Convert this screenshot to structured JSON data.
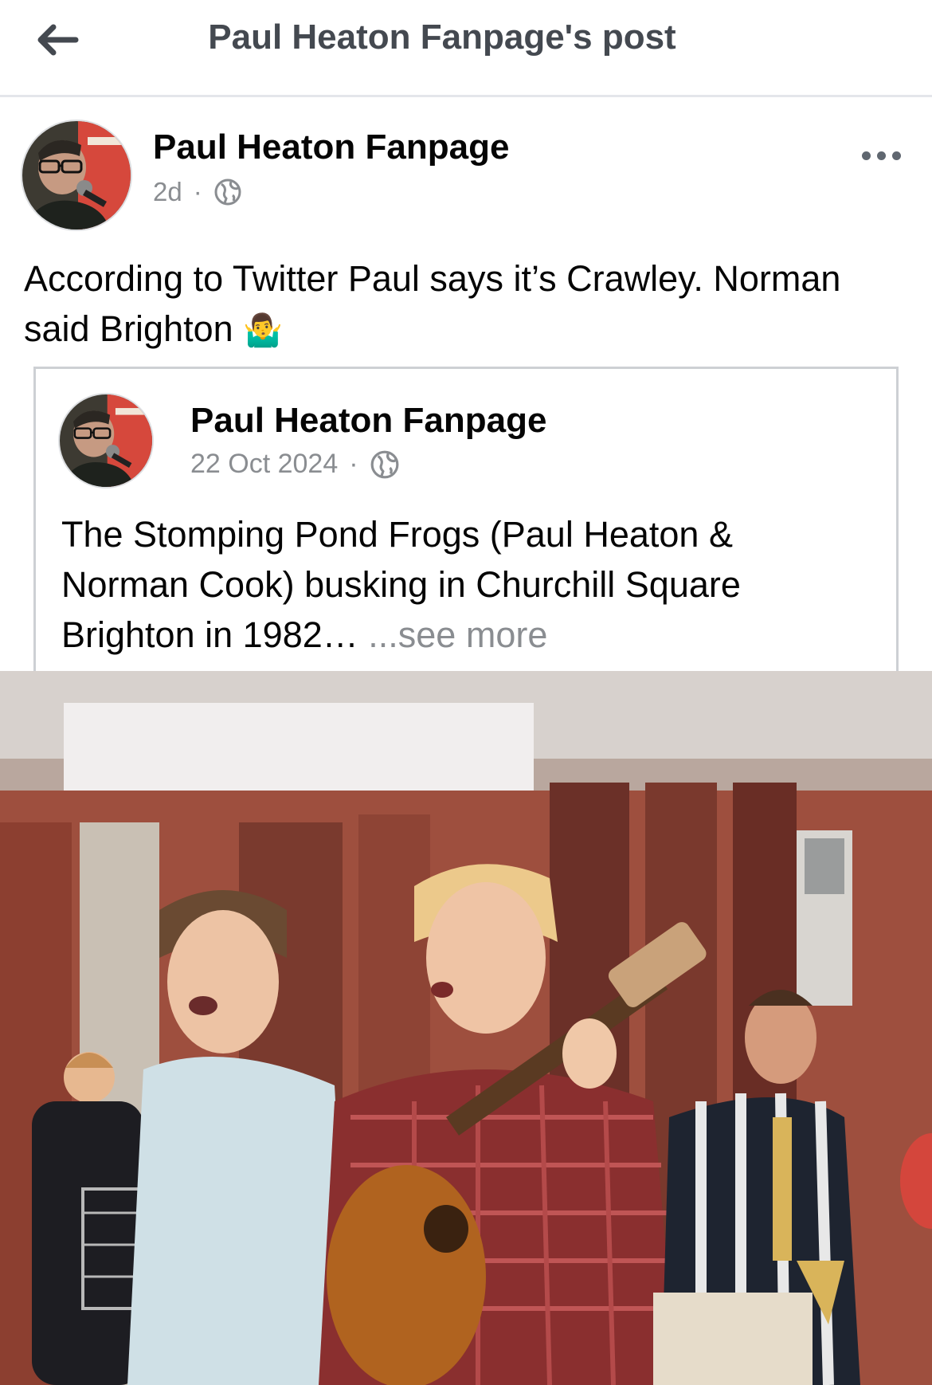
{
  "header": {
    "title": "Paul Heaton Fanpage's post"
  },
  "post": {
    "author": "Paul Heaton Fanpage",
    "time": "2d",
    "separator": "·",
    "privacy_icon": "globe-icon",
    "text": "According to Twitter Paul says it’s Crawley. Norman said Brighton",
    "emoji": "🤷‍♂️"
  },
  "shared_post": {
    "author": "Paul Heaton Fanpage",
    "date": "22 Oct 2024",
    "separator": "·",
    "privacy_icon": "globe-icon",
    "text": "The Stomping Pond Frogs (Paul Heaton & Norman Cook) busking in Churchill Square Brighton in 1982…",
    "see_more": "...see more"
  },
  "icons": {
    "back": "arrow-left-icon",
    "more": "more-options-icon"
  },
  "colors": {
    "meta_text": "#8a8d91",
    "title_text": "#444950",
    "divider": "#e4e6eb"
  }
}
